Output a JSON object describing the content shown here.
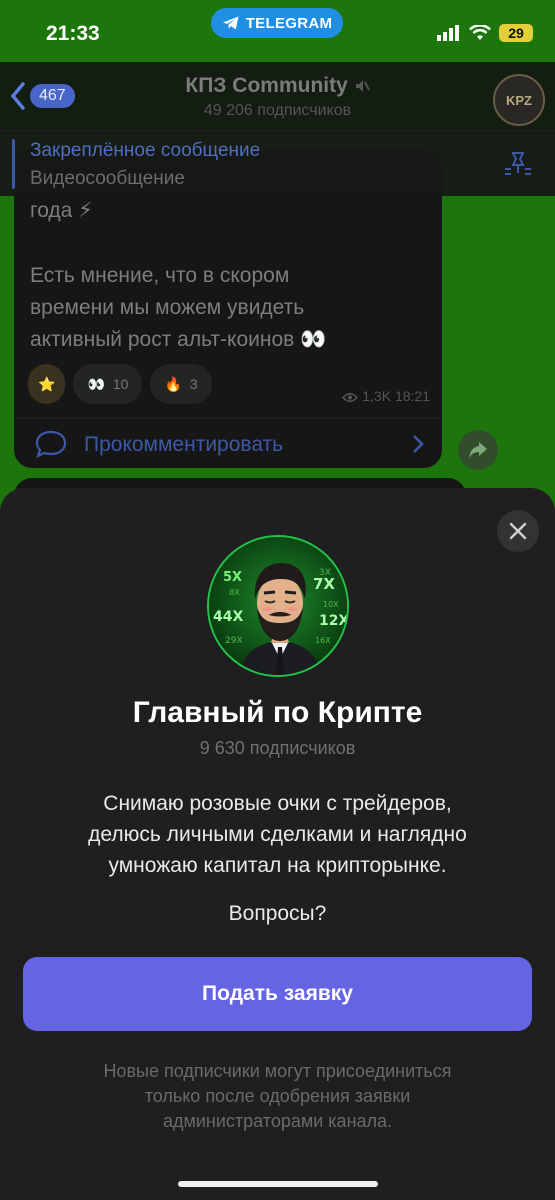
{
  "status_bar": {
    "time": "21:33",
    "pill_label": "TELEGRAM",
    "battery": "29"
  },
  "header": {
    "unread_count": "467",
    "title": "КПЗ Community",
    "subtitle": "49 206 подписчиков",
    "avatar_text": "KPZ"
  },
  "pinned": {
    "title": "Закреплённое сообщение",
    "text": "Видеосообщение"
  },
  "message": {
    "line1": "года ⚡",
    "line2": "Есть мнение, что в скором",
    "line3": "времени мы можем увидеть",
    "line4": "активный рост альт-коинов 👀",
    "reactions": [
      {
        "emoji": "⭐",
        "count": ""
      },
      {
        "emoji": "👀",
        "count": "10"
      },
      {
        "emoji": "🔥",
        "count": "3"
      }
    ],
    "views": "1,3K",
    "time": "18:21",
    "comment_label": "Прокомментировать"
  },
  "sheet": {
    "channel_name": "Главный по Крипте",
    "subscribers": "9 630 подписчиков",
    "description": [
      "Снимаю розовые очки с трейдеров,",
      "делюсь личными сделками и наглядно",
      "умножаю капитал на крипторынке."
    ],
    "questions": "Вопросы?",
    "apply_label": "Подать заявку",
    "note": [
      "Новые подписчики могут присоединиться",
      "только после одобрения заявки",
      "администраторами канала."
    ],
    "avatar_labels": [
      "5X",
      "7X",
      "44X",
      "12X",
      "29X",
      "3X",
      "8X",
      "10X",
      "16X"
    ]
  },
  "colors": {
    "accent": "#6565e4",
    "chat_bg": "#2fbe14",
    "sheet_bg": "#1f1f1f"
  }
}
